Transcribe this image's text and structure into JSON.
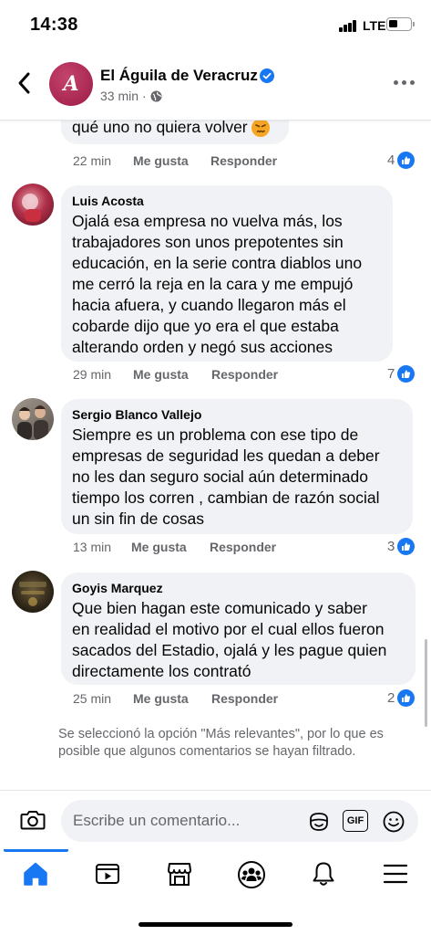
{
  "status_bar": {
    "time": "14:38",
    "network": "LTE"
  },
  "header": {
    "page_name": "El Águila de Veracruz",
    "time": "33 min",
    "avatar_letter": "A"
  },
  "comments": [
    {
      "author": "",
      "text_lines": [
        "qué uno no quiera volver"
      ],
      "time": "22 min",
      "like_label": "Me gusta",
      "reply_label": "Responder",
      "reactions": "4"
    },
    {
      "author": "Luis Acosta",
      "text_lines": [
        "Ojalá esa empresa no vuelva más, los",
        "trabajadores son unos prepotentes sin",
        "educación, en la serie contra diablos uno",
        "me cerró la reja en la cara y me empujó",
        "hacia afuera, y cuando llegaron más el",
        "cobarde dijo que yo era el que estaba",
        "alterando orden y negó sus acciones"
      ],
      "time": "29 min",
      "like_label": "Me gusta",
      "reply_label": "Responder",
      "reactions": "7"
    },
    {
      "author": "Sergio Blanco Vallejo",
      "text_lines": [
        "Siempre es un problema con ese tipo de",
        "empresas de seguridad les quedan a deber",
        "no les dan seguro social aún determinado",
        "tiempo los corren , cambian de razón social",
        "un sin fin de cosas"
      ],
      "time": "13 min",
      "like_label": "Me gusta",
      "reply_label": "Responder",
      "reactions": "3"
    },
    {
      "author": "Goyis Marquez",
      "text_lines": [
        "Que bien hagan este comunicado y saber",
        "en realidad el motivo por el cual ellos fueron",
        "sacados del Estadio, ojalá y les pague quien",
        "directamente los contrató"
      ],
      "time": "25 min",
      "like_label": "Me gusta",
      "reply_label": "Responder",
      "reactions": "2"
    }
  ],
  "filter_note": "Se seleccionó la opción \"Más relevantes\", por lo que es posible que algunos comentarios se hayan filtrado.",
  "composer": {
    "placeholder": "Escribe un comentario...",
    "gif_label": "GIF"
  },
  "colors": {
    "accent": "#1877f2",
    "bubble": "#f0f2f5",
    "muted": "#65676b"
  },
  "nav": [
    "home-icon",
    "video-icon",
    "marketplace-icon",
    "groups-icon",
    "bell-icon",
    "menu-icon"
  ]
}
